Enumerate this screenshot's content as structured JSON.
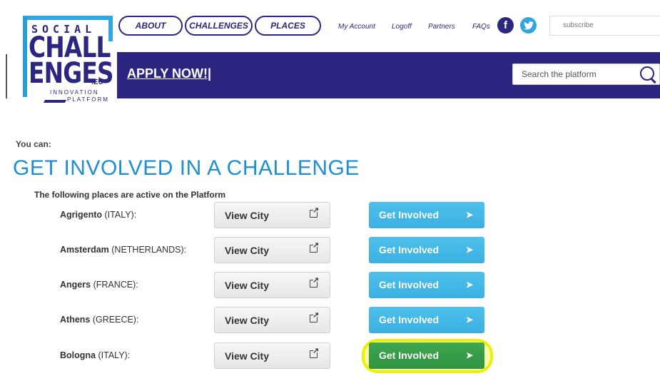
{
  "logo": {
    "line1": "SOCIAL",
    "line2": "CHALL",
    "line3": "ENGES",
    "suffix": ".EU",
    "tagline1": "INNOVATION",
    "tagline2": "PLATFORM"
  },
  "nav": {
    "pills": [
      "ABOUT",
      "CHALLENGES",
      "PLACES"
    ],
    "links": [
      "My Account",
      "Logoff",
      "Partners",
      "FAQs"
    ],
    "subscribe_placeholder": "subscribe"
  },
  "banner": {
    "apply": "APPLY NOW!|",
    "search_placeholder": "Search the platform"
  },
  "main": {
    "intro": "You can:",
    "title": "GET INVOLVED IN A CHALLENGE",
    "subtitle": "The following places are active on the Platform",
    "view_label": "View City",
    "involve_label": "Get Involved",
    "places": [
      {
        "city": "Agrigento",
        "country": "(ITALY):"
      },
      {
        "city": "Amsterdam",
        "country": "(NETHERLANDS):"
      },
      {
        "city": "Angers",
        "country": "(FRANCE):"
      },
      {
        "city": "Athens",
        "country": "(GREECE):"
      },
      {
        "city": "Bologna",
        "country": "(ITALY):"
      }
    ]
  },
  "colors": {
    "brand": "#2c2680",
    "accent": "#1f8fd2",
    "button": "#3ab0e2",
    "highlight": "#eef000"
  }
}
